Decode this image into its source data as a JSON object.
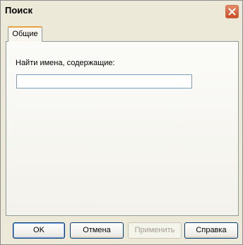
{
  "window": {
    "title": "Поиск"
  },
  "tabs": [
    {
      "label": "Общие"
    }
  ],
  "search": {
    "label": "Найти имена, содержащие:",
    "value": ""
  },
  "buttons": {
    "ok": "OK",
    "cancel": "Отмена",
    "apply": "Применить",
    "help": "Справка"
  }
}
